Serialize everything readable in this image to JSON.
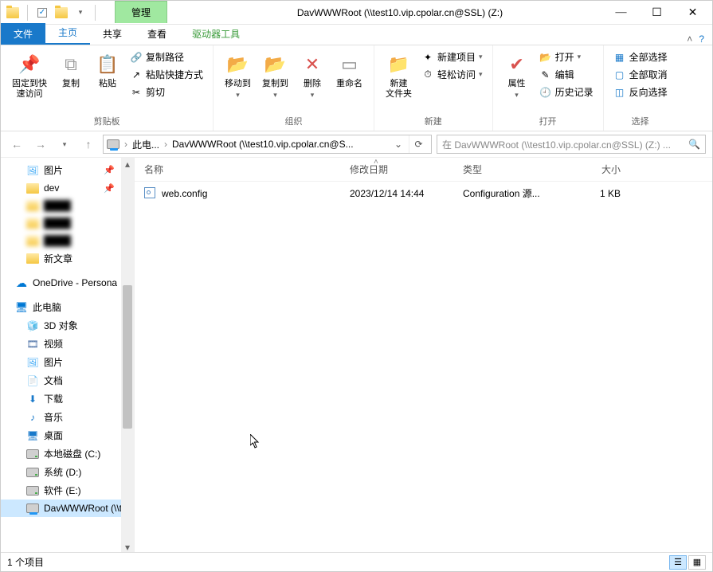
{
  "title": "DavWWWRoot (\\\\test10.vip.cpolar.cn@SSL) (Z:)",
  "context_tab": "管理",
  "context_tools": "驱动器工具",
  "tabs": {
    "file": "文件",
    "home": "主页",
    "share": "共享",
    "view": "查看"
  },
  "ribbon": {
    "pin": "固定到快\n速访问",
    "copy": "复制",
    "paste": "粘贴",
    "copy_path": "复制路径",
    "paste_shortcut": "粘贴快捷方式",
    "cut": "剪切",
    "clipboard_group": "剪贴板",
    "move_to": "移动到",
    "copy_to": "复制到",
    "delete": "删除",
    "rename": "重命名",
    "organize_group": "组织",
    "new_folder": "新建\n文件夹",
    "new_item": "新建项目",
    "easy_access": "轻松访问",
    "new_group": "新建",
    "properties": "属性",
    "open": "打开",
    "edit": "编辑",
    "history": "历史记录",
    "open_group": "打开",
    "select_all": "全部选择",
    "select_none": "全部取消",
    "invert": "反向选择",
    "select_group": "选择"
  },
  "breadcrumb": {
    "pc": "此电...",
    "path": "DavWWWRoot (\\\\test10.vip.cpolar.cn@S..."
  },
  "search_placeholder": "在 DavWWWRoot (\\\\test10.vip.cpolar.cn@SSL) (Z:) ...",
  "tree": {
    "pictures": "图片",
    "dev": "dev",
    "hidden1": "████",
    "hidden2": "████",
    "hidden3": "████",
    "new_article": "新文章",
    "onedrive": "OneDrive - Persona",
    "this_pc": "此电脑",
    "obj3d": "3D 对象",
    "videos": "视频",
    "pictures2": "图片",
    "documents": "文档",
    "downloads": "下载",
    "music": "音乐",
    "desktop": "桌面",
    "local_c": "本地磁盘 (C:)",
    "sys_d": "系统 (D:)",
    "soft_e": "软件 (E:)",
    "dav": "DavWWWRoot (\\\\t"
  },
  "columns": {
    "name": "名称",
    "date": "修改日期",
    "type": "类型",
    "size": "大小"
  },
  "files": [
    {
      "name": "web.config",
      "date": "2023/12/14 14:44",
      "type": "Configuration 源...",
      "size": "1 KB"
    }
  ],
  "status": "1 个项目"
}
